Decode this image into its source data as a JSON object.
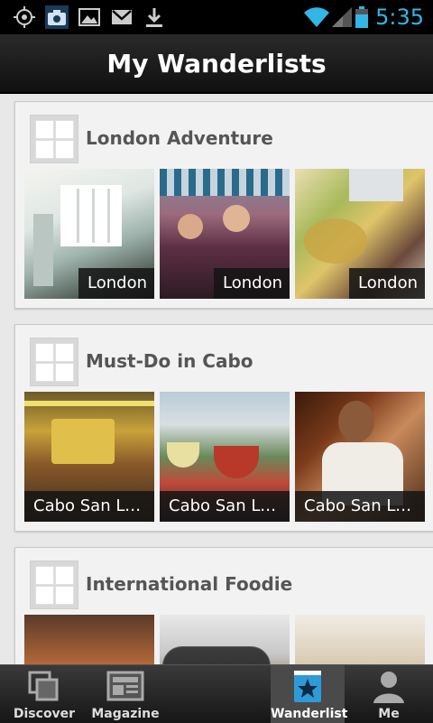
{
  "status_bar": {
    "time": "5:35",
    "icons": [
      "gps-icon",
      "camera-notification-icon",
      "image-icon",
      "gmail-icon",
      "download-icon",
      "wifi-icon",
      "signal-icon",
      "battery-icon"
    ]
  },
  "header": {
    "title": "My Wanderlists"
  },
  "lists": [
    {
      "title": "London Adventure",
      "photos": [
        {
          "caption": "London"
        },
        {
          "caption": "London"
        },
        {
          "caption": "London"
        }
      ]
    },
    {
      "title": "Must-Do in Cabo",
      "photos": [
        {
          "caption": "Cabo San Luc..."
        },
        {
          "caption": "Cabo San Luc..."
        },
        {
          "caption": "Cabo San Luc..."
        }
      ]
    },
    {
      "title": "International Foodie",
      "photos": [
        {
          "caption": ""
        },
        {
          "caption": ""
        },
        {
          "caption": ""
        }
      ]
    }
  ],
  "tabs": [
    {
      "label": "Discover",
      "icon": "discover-icon"
    },
    {
      "label": "Magazine",
      "icon": "magazine-icon"
    },
    {
      "label": "",
      "icon": "camera-icon"
    },
    {
      "label": "Wanderlist",
      "icon": "wanderlist-star-icon",
      "active": true
    },
    {
      "label": "Me",
      "icon": "person-icon"
    }
  ],
  "colors": {
    "accent": "#33b5e5",
    "active_tab_icon": "#2f9ad8"
  }
}
